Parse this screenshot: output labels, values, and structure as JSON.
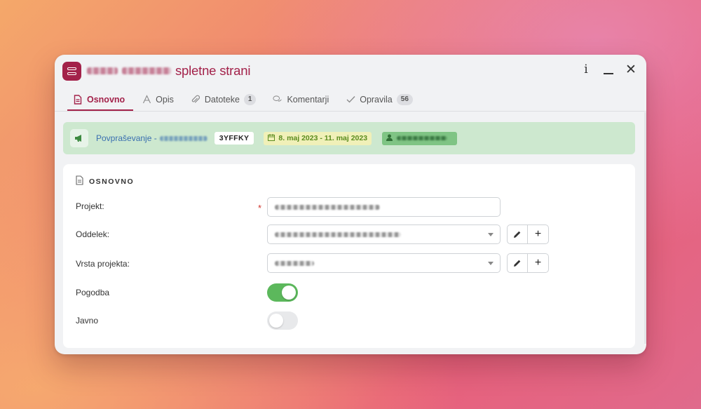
{
  "window": {
    "title_suffix": "spletne strani",
    "controls": {
      "info": "i",
      "minimize": "minimize",
      "close": "✕"
    }
  },
  "tabs": [
    {
      "label": "Osnovno",
      "icon": "document-icon",
      "active": true
    },
    {
      "label": "Opis",
      "icon": "text-icon",
      "active": false
    },
    {
      "label": "Datoteke",
      "icon": "paperclip-icon",
      "badge": "1",
      "active": false
    },
    {
      "label": "Komentarji",
      "icon": "comments-icon",
      "active": false
    },
    {
      "label": "Opravila",
      "icon": "checkmark-icon",
      "badge": "56",
      "active": false
    }
  ],
  "banner": {
    "link_prefix": "Povpraševanje -",
    "code": "3YFFKY",
    "date_range": "8. maj 2023 - 11. maj 2023"
  },
  "section": {
    "title": "OSNOVNO",
    "fields": {
      "projekt": "Projekt:",
      "oddelek": "Oddelek:",
      "vrsta_projekta": "Vrsta projekta:",
      "pogodba": "Pogodba",
      "javno": "Javno"
    },
    "required_mark": "*",
    "pogodba_on": true,
    "javno_on": false,
    "add_label": "+"
  },
  "colors": {
    "accent": "#a3224a",
    "banner_bg": "#cde8cf",
    "toggle_on": "#5cb85c",
    "link": "#3a6fb0"
  }
}
